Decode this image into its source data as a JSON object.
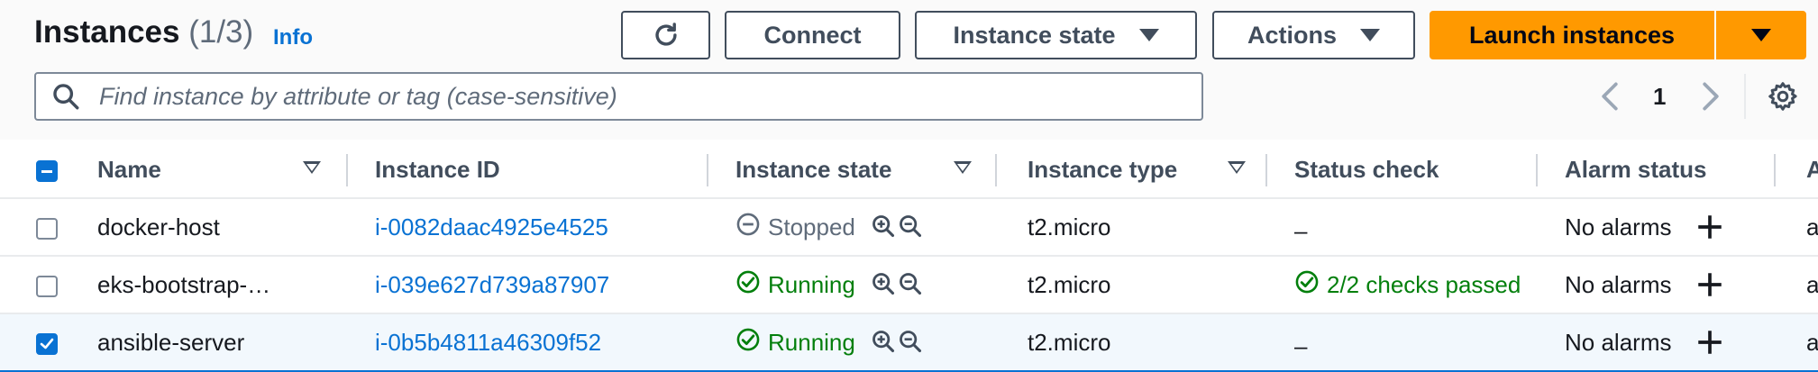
{
  "header": {
    "title": "Instances",
    "count": "(1/3)",
    "info": "Info"
  },
  "toolbar": {
    "refresh_icon": "refresh-icon",
    "connect": "Connect",
    "instance_state": "Instance state",
    "actions": "Actions",
    "launch": "Launch instances"
  },
  "search": {
    "placeholder": "Find instance by attribute or tag (case-sensitive)",
    "value": ""
  },
  "pagination": {
    "page": "1"
  },
  "columns": {
    "name": "Name",
    "instance_id": "Instance ID",
    "instance_state": "Instance state",
    "instance_type": "Instance type",
    "status_check": "Status check",
    "alarm_status": "Alarm status",
    "next": "A"
  },
  "rows": [
    {
      "name": "docker-host",
      "id": "i-0082daac4925e4525",
      "state": "Stopped",
      "type": "t2.micro",
      "status": "–",
      "alarm": "No alarms",
      "next": "ap",
      "selected": false
    },
    {
      "name": "eks-bootstrap-…",
      "id": "i-039e627d739a87907",
      "state": "Running",
      "type": "t2.micro",
      "status": "2/2 checks passed",
      "alarm": "No alarms",
      "next": "ap",
      "selected": false
    },
    {
      "name": "ansible-server",
      "id": "i-0b5b4811a46309f52",
      "state": "Running",
      "type": "t2.micro",
      "status": "–",
      "alarm": "No alarms",
      "next": "ap",
      "selected": true
    }
  ],
  "colors": {
    "primary": "#ff9900",
    "link": "#0972d3",
    "success": "#037f0c",
    "stopped": "#5f6b7a"
  }
}
